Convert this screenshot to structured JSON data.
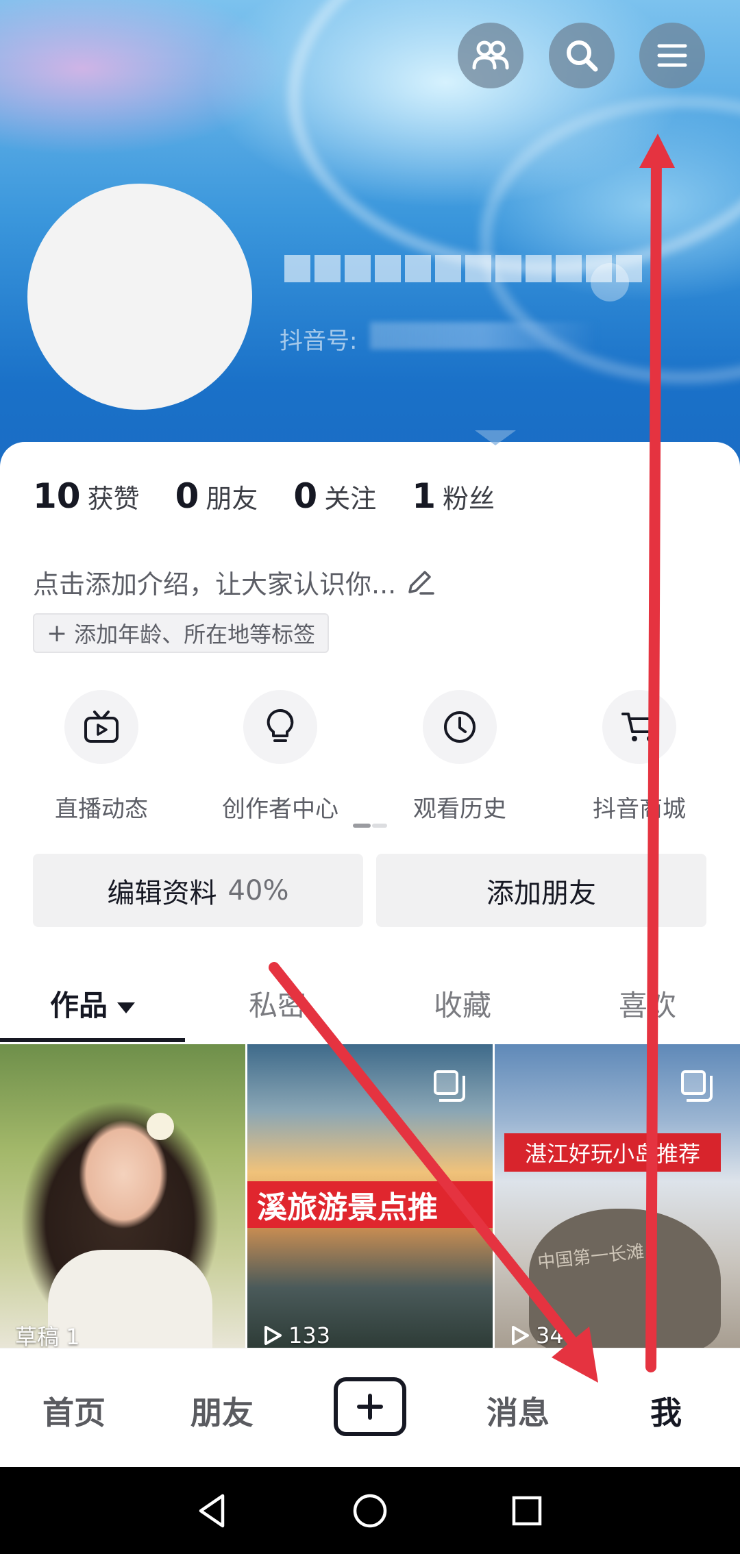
{
  "header": {
    "douyin_id_label": "抖音号: ",
    "icons": [
      "friends-icon",
      "search-icon",
      "menu-icon"
    ]
  },
  "stats": [
    {
      "num": "10",
      "label": "获赞"
    },
    {
      "num": "0",
      "label": "朋友"
    },
    {
      "num": "0",
      "label": "关注"
    },
    {
      "num": "1",
      "label": "粉丝"
    }
  ],
  "bio": {
    "placeholder": "点击添加介绍，让大家认识你...",
    "tag_label": "添加年龄、所在地等标签"
  },
  "shortcuts": [
    {
      "label": "直播动态",
      "icon": "live-tv-icon"
    },
    {
      "label": "创作者中心",
      "icon": "lightbulb-icon"
    },
    {
      "label": "观看历史",
      "icon": "clock-icon"
    },
    {
      "label": "抖音商城",
      "icon": "cart-icon"
    }
  ],
  "actions": {
    "edit_profile": "编辑资料",
    "edit_percent": "40%",
    "add_friend": "添加朋友"
  },
  "tabs": [
    "作品",
    "私密",
    "收藏",
    "喜欢"
  ],
  "grid": [
    {
      "caption": "草稿 1"
    },
    {
      "banner": "溪旅游景点推",
      "caption": "133"
    },
    {
      "banner": "湛江好玩小岛推荐",
      "rock_text": "中国第一长滩",
      "caption": "34"
    }
  ],
  "bottom_nav": {
    "home": "首页",
    "friends": "朋友",
    "messages": "消息",
    "me": "我"
  },
  "colors": {
    "arrow": "#e53340",
    "text_primary": "#161823",
    "header_blue": "#1b6cc4"
  }
}
